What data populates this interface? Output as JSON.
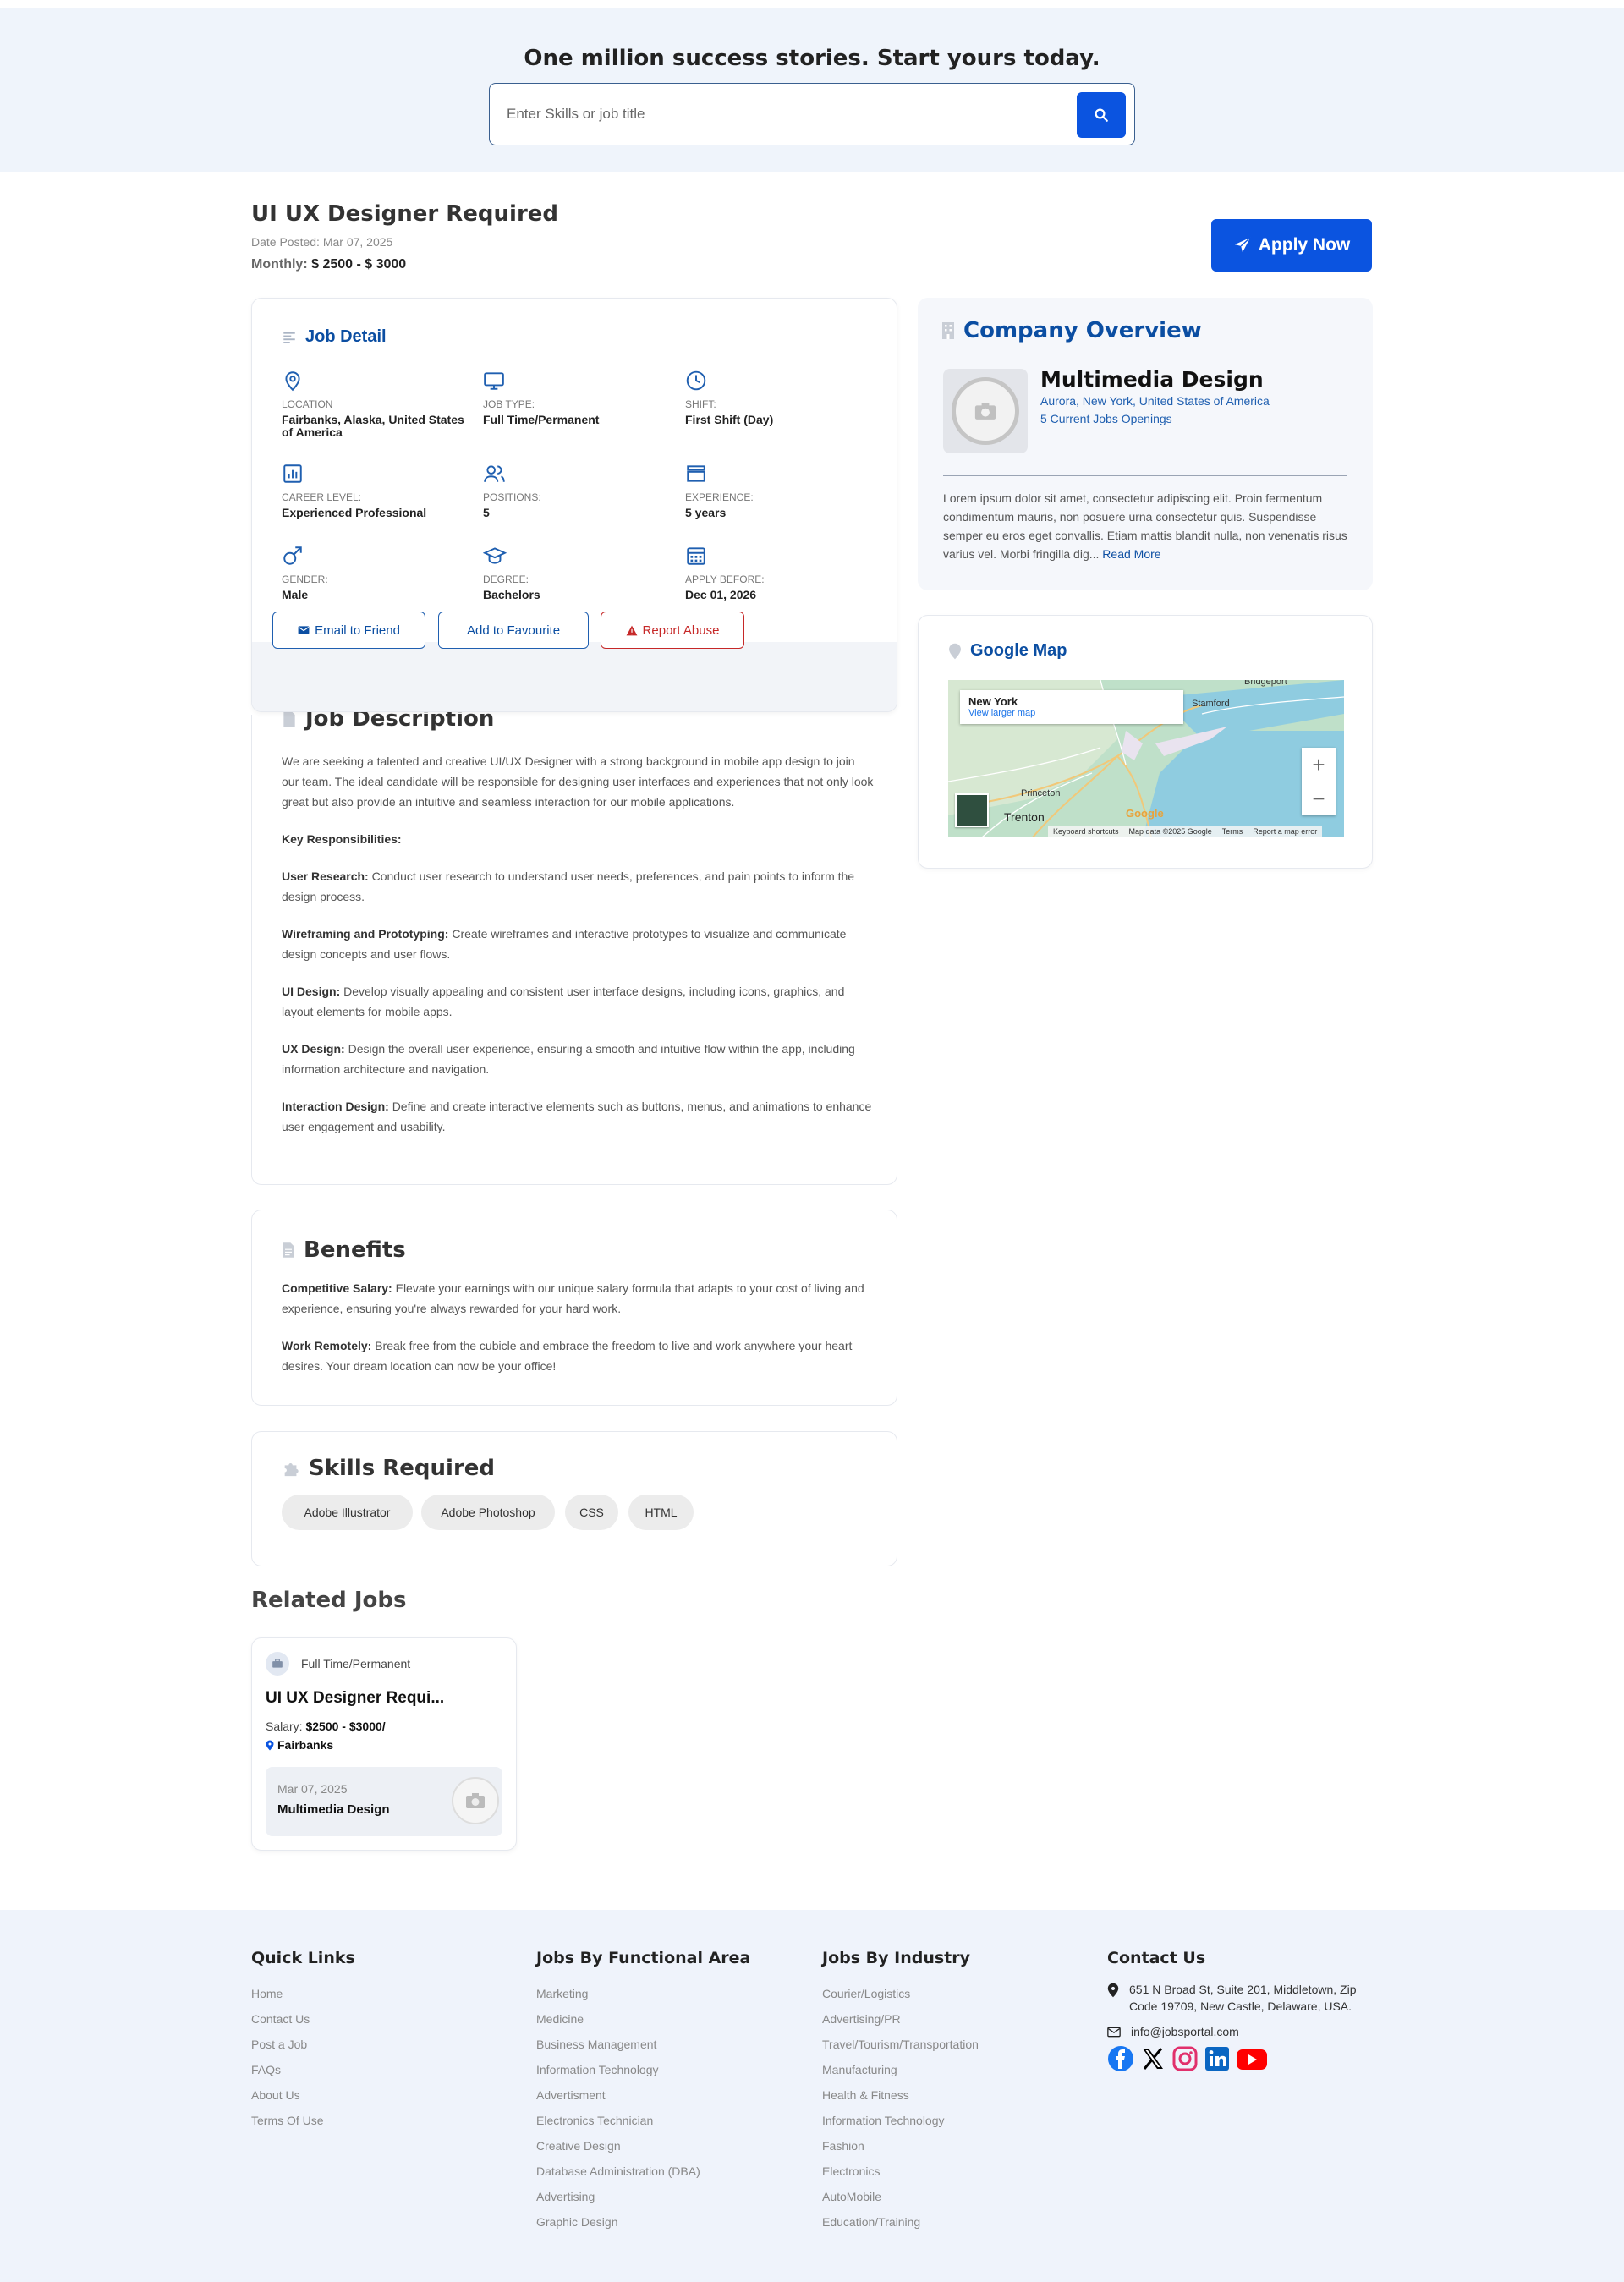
{
  "hero": {
    "title": "One million success stories. Start yours today.",
    "search_placeholder": "Enter Skills or job title"
  },
  "job": {
    "title": "UI UX Designer Required",
    "date_posted": "Date Posted: Mar 07, 2025",
    "salary_label": "Monthly:",
    "salary_value": "$ 2500 - $ 3000",
    "apply_label": "Apply Now"
  },
  "job_detail": {
    "heading": "Job Detail",
    "items": [
      {
        "icon": "location-icon",
        "label": "LOCATION",
        "value": "Fairbanks, Alaska, United States of America"
      },
      {
        "icon": "monitor-icon",
        "label": "JOB TYPE:",
        "value": "Full Time/Permanent"
      },
      {
        "icon": "clock-icon",
        "label": "SHIFT:",
        "value": "First Shift (Day)"
      },
      {
        "icon": "chart-icon",
        "label": "CAREER LEVEL:",
        "value": "Experienced Professional"
      },
      {
        "icon": "users-icon",
        "label": "POSITIONS:",
        "value": "5"
      },
      {
        "icon": "briefcase-icon",
        "label": "EXPERIENCE:",
        "value": "5 years"
      },
      {
        "icon": "gender-icon",
        "label": "GENDER:",
        "value": "Male"
      },
      {
        "icon": "graduation-cap-icon",
        "label": "DEGREE:",
        "value": "Bachelors"
      },
      {
        "icon": "calendar-icon",
        "label": "APPLY BEFORE:",
        "value": "Dec 01, 2026"
      }
    ],
    "buttons": {
      "email": "Email to Friend",
      "favourite": "Add to Favourite",
      "report": "Report Abuse"
    }
  },
  "description": {
    "heading": "Job Description",
    "intro": "We are seeking a talented and creative UI/UX Designer with a strong background in mobile app design to join our team. The ideal candidate will be responsible for designing user interfaces and experiences that not only look great but also provide an intuitive and seamless interaction for our mobile applications.",
    "key_heading": "Key Responsibilities:",
    "items": [
      {
        "title": "User Research:",
        "text": "Conduct user research to understand user needs, preferences, and pain points to inform the design process."
      },
      {
        "title": "Wireframing and Prototyping:",
        "text": "Create wireframes and interactive prototypes to visualize and communicate design concepts and user flows."
      },
      {
        "title": "UI Design:",
        "text": "Develop visually appealing and consistent user interface designs, including icons, graphics, and layout elements for mobile apps."
      },
      {
        "title": "UX Design:",
        "text": "Design the overall user experience, ensuring a smooth and intuitive flow within the app, including information architecture and navigation."
      },
      {
        "title": "Interaction Design:",
        "text": "Define and create interactive elements such as buttons, menus, and animations to enhance user engagement and usability."
      }
    ]
  },
  "benefits": {
    "heading": "Benefits",
    "items": [
      {
        "title": "Competitive Salary:",
        "text": "Elevate your earnings with our unique salary formula that adapts to your cost of living and experience, ensuring you're always rewarded for your hard work."
      },
      {
        "title": "Work Remotely:",
        "text": "Break free from the cubicle and embrace the freedom to live and work anywhere your heart desires. Your dream location can now be your office!"
      }
    ]
  },
  "skills": {
    "heading": "Skills Required",
    "items": [
      "Adobe Illustrator",
      "Adobe Photoshop",
      "CSS",
      "HTML"
    ]
  },
  "related": {
    "heading": "Related Jobs",
    "card": {
      "type": "Full Time/Permanent",
      "title": "UI UX Designer Requi...",
      "salary_label": "Salary:",
      "salary_value": "$2500 - $3000/",
      "location": "Fairbanks",
      "date": "Mar 07, 2025",
      "company": "Multimedia Design"
    }
  },
  "company": {
    "heading": "Company Overview",
    "name": "Multimedia Design",
    "location": "Aurora, New York, United States of America",
    "openings": "5 Current Jobs Openings",
    "logo_text": "NO PHOTO",
    "about": "Lorem ipsum dolor sit amet, consectetur adipiscing elit. Proin fermentum condimentum mauris, non posuere urna consectetur quis. Suspendisse semper eu eros eget convallis. Etiam mattis blandit nulla, non venenatis risus varius vel. Morbi fringilla dig...",
    "read_more": "Read More"
  },
  "map": {
    "heading": "Google Map",
    "place": "New York",
    "view_larger": "View larger map",
    "labels": {
      "stamford": "Stamford",
      "bridgeport": "Bridgeport",
      "princeton": "Princeton",
      "trenton": "Trenton",
      "google": "Google"
    },
    "attribution": [
      "Keyboard shortcuts",
      "Map data ©2025 Google",
      "Terms",
      "Report a map error"
    ],
    "zoom_in": "+",
    "zoom_out": "−"
  },
  "footer": {
    "quick_links": {
      "heading": "Quick Links",
      "items": [
        "Home",
        "Contact Us",
        "Post a Job",
        "FAQs",
        "About Us",
        "Terms Of Use"
      ]
    },
    "functional": {
      "heading": "Jobs By Functional Area",
      "items": [
        "Marketing",
        "Medicine",
        "Business Management",
        "Information Technology",
        "Advertisment",
        "Electronics Technician",
        "Creative Design",
        "Database Administration (DBA)",
        "Advertising",
        "Graphic Design"
      ]
    },
    "industry": {
      "heading": "Jobs By Industry",
      "items": [
        "Courier/Logistics",
        "Advertising/PR",
        "Travel/Tourism/Transportation",
        "Manufacturing",
        "Health & Fitness",
        "Information Technology",
        "Fashion",
        "Electronics",
        "AutoMobile",
        "Education/Training"
      ]
    },
    "contact": {
      "heading": "Contact Us",
      "address": "651 N Broad St, Suite 201, Middletown, Zip Code 19709, New Castle, Delaware, USA.",
      "email": "info@jobsportal.com"
    }
  },
  "colors": {
    "accent": "#0b54e0",
    "heading_blue": "#0b4ea2",
    "hero_bg": "#eff4fb",
    "report_red": "#c62828"
  }
}
